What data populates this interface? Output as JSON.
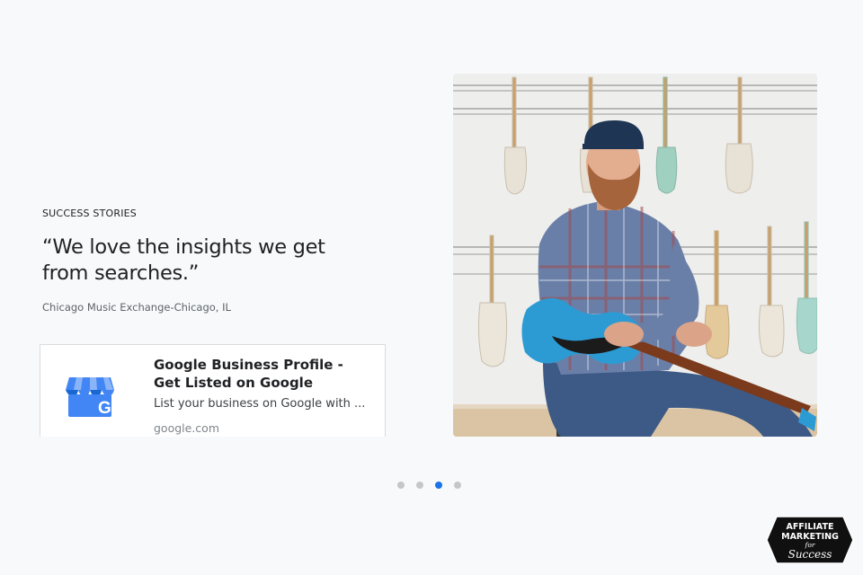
{
  "story": {
    "eyebrow": "SUCCESS STORIES",
    "quote": "“We love the insights we get from searches.”",
    "attribution": "Chicago Music Exchange-Chicago, IL"
  },
  "link_card": {
    "title": "Google Business Profile - Get Listed on Google",
    "description": "List your business on Google with ...",
    "domain": "google.com",
    "icon": "google-business-store-icon"
  },
  "photo": {
    "alt": "Man with beard holding a blue electric guitar in a guitar shop"
  },
  "carousel": {
    "total": 4,
    "active_index": 2
  },
  "watermark": {
    "line1": "AFFILIATE",
    "line2": "MARKETING",
    "line3": "for",
    "line4": "Success"
  },
  "colors": {
    "accent": "#1a73e8",
    "background": "#f7f9fb",
    "dot_inactive": "#c4c7c5"
  }
}
